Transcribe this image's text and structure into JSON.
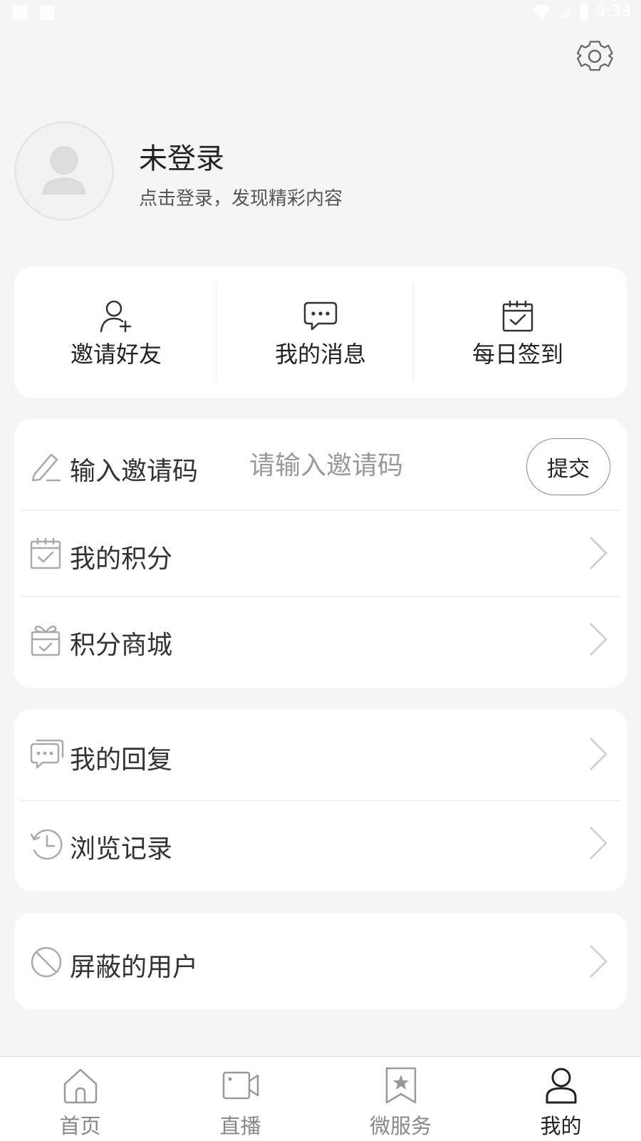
{
  "status_bar": {
    "time": "9:33"
  },
  "profile": {
    "name": "未登录",
    "subtitle": "点击登录，发现精彩内容"
  },
  "quick_actions": [
    {
      "label": "邀请好友",
      "icon": "add-user-icon"
    },
    {
      "label": "我的消息",
      "icon": "chat-bubble-icon"
    },
    {
      "label": "每日签到",
      "icon": "calendar-check-icon"
    }
  ],
  "invite": {
    "label": "输入邀请码",
    "placeholder": "请输入邀请码",
    "value": "",
    "submit": "提交"
  },
  "points_menu": [
    {
      "label": "我的积分",
      "icon": "calendar-check-icon"
    },
    {
      "label": "积分商城",
      "icon": "gift-icon"
    }
  ],
  "activity_menu": [
    {
      "label": "我的回复",
      "icon": "reply-bubble-icon"
    },
    {
      "label": "浏览记录",
      "icon": "history-icon"
    }
  ],
  "block_menu": [
    {
      "label": "屏蔽的用户",
      "icon": "block-icon"
    }
  ],
  "tabbar": {
    "active": 3,
    "items": [
      {
        "label": "首页",
        "icon": "home-icon"
      },
      {
        "label": "直播",
        "icon": "video-camera-icon"
      },
      {
        "label": "微服务",
        "icon": "star-bookmark-icon"
      },
      {
        "label": "我的",
        "icon": "user-icon"
      }
    ]
  },
  "colors": {
    "background": "#f5f5f5",
    "card": "#ffffff",
    "text_primary": "#222222",
    "text_secondary": "#555555",
    "icon_gray": "#aaaaaa",
    "tab_inactive": "#888888"
  }
}
